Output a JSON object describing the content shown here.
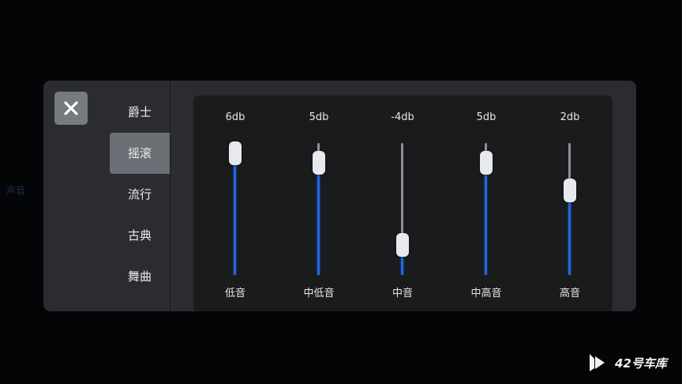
{
  "background_hint": "声音",
  "presets": [
    {
      "label": "爵士",
      "selected": false
    },
    {
      "label": "摇滚",
      "selected": true
    },
    {
      "label": "流行",
      "selected": false
    },
    {
      "label": "古典",
      "selected": false
    },
    {
      "label": "舞曲",
      "selected": false
    }
  ],
  "bands": [
    {
      "label": "低音",
      "value_text": "6db",
      "level": 0.92
    },
    {
      "label": "中低音",
      "value_text": "5db",
      "level": 0.85
    },
    {
      "label": "中音",
      "value_text": "-4db",
      "level": 0.23
    },
    {
      "label": "中高音",
      "value_text": "5db",
      "level": 0.85
    },
    {
      "label": "高音",
      "value_text": "2db",
      "level": 0.64
    }
  ],
  "watermark": {
    "text": "42号车库"
  },
  "colors": {
    "accent_fill": "#1f6ae6",
    "panel": "#2b2c2f",
    "eq_area": "#1a1b1d",
    "selected_preset": "#6b6e74"
  },
  "icons": {
    "close": "close-icon",
    "watermark_logo": "play-logo-icon"
  }
}
